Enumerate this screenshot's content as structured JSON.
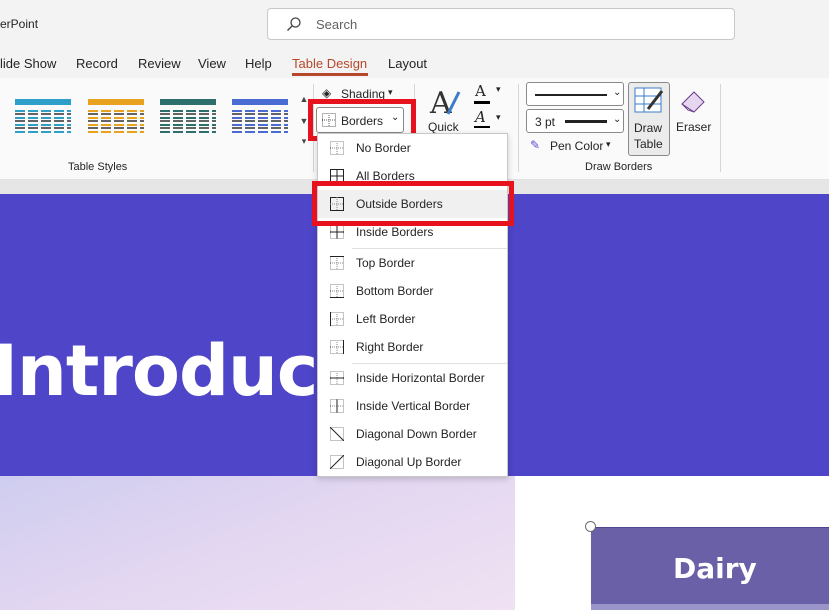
{
  "app": {
    "title": "erPoint"
  },
  "search": {
    "placeholder": "Search"
  },
  "tabs": [
    {
      "label": "lide Show"
    },
    {
      "label": "Record"
    },
    {
      "label": "Review"
    },
    {
      "label": "View"
    },
    {
      "label": "Help"
    },
    {
      "label": "Table Design",
      "active": true
    },
    {
      "label": "Layout"
    }
  ],
  "ribbon": {
    "table_styles_label": "Table Styles",
    "shading_label": "Shading",
    "borders_label": "Borders",
    "quick_label": "Quick",
    "pen_weight": "3 pt",
    "pen_color_label": "Pen Color",
    "draw_table_label_1": "Draw",
    "draw_table_label_2": "Table",
    "eraser_label": "Eraser",
    "draw_borders_label": "Draw Borders",
    "style_colors": [
      "#2e9fc8",
      "#e8a21f",
      "#2d6f6c",
      "#4a6bd2"
    ]
  },
  "borders_menu": {
    "items": [
      {
        "label": "No Border",
        "icon": "no-border-icon"
      },
      {
        "label": "All Borders",
        "icon": "all-borders-icon"
      },
      {
        "label": "Outside Borders",
        "icon": "outside-borders-icon",
        "hover": true
      },
      {
        "label": "Inside Borders",
        "icon": "inside-borders-icon"
      },
      {
        "label": "Top Border",
        "icon": "top-border-icon"
      },
      {
        "label": "Bottom Border",
        "icon": "bottom-border-icon"
      },
      {
        "label": "Left Border",
        "icon": "left-border-icon"
      },
      {
        "label": "Right Border",
        "icon": "right-border-icon"
      },
      {
        "label": "Inside Horizontal Border",
        "icon": "inside-horizontal-border-icon"
      },
      {
        "label": "Inside Vertical Border",
        "icon": "inside-vertical-border-icon"
      },
      {
        "label": "Diagonal Down Border",
        "icon": "diagonal-down-border-icon"
      },
      {
        "label": "Diagonal Up Border",
        "icon": "diagonal-up-border-icon"
      }
    ]
  },
  "slide": {
    "title": "Introduct",
    "table_cell": "Dairy",
    "header_color": "#4e45c8"
  },
  "colors": {
    "accent": "#b7472a",
    "highlight": "#e8121f"
  }
}
